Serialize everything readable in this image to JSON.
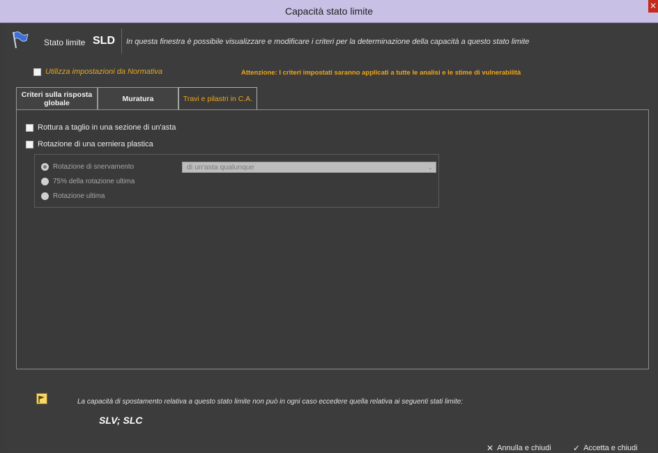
{
  "window": {
    "title": "Capacità stato limite",
    "close_glyph": "×"
  },
  "header": {
    "icon": "blue-flag-icon",
    "stato_label": "Stato limite",
    "stato_code": "SLD",
    "description": "In questa finestra è possibile visualizzare e modificare i criteri per la determinazione della capacità a questo stato limite"
  },
  "normativa": {
    "label": "Utilizza impostazioni da Normativa",
    "checked": false
  },
  "attention": "Attenzione: I criteri impostati saranno applicati a tutte le analisi e le stime di vulnerabilità",
  "tabs": [
    {
      "label": "Criteri sulla risposta globale",
      "active": false
    },
    {
      "label": "Muratura",
      "active": false
    },
    {
      "label": "Travi e pilastri in C.A.",
      "active": true
    }
  ],
  "panel": {
    "options": [
      {
        "label": "Rottura a taglio in una sezione di un'asta",
        "checked": false
      },
      {
        "label": "Rotazione di una cerniera plastica",
        "checked": false
      }
    ],
    "radios": [
      {
        "label": "Rotazione di snervamento",
        "selected": true
      },
      {
        "label": "75% della rotazione ultima",
        "selected": false
      },
      {
        "label": "Rotazione ultima",
        "selected": false
      }
    ],
    "select_value": "di un'asta qualunque"
  },
  "footer": {
    "info_icon": "yellow-flag-icon",
    "info_text": "La capacità di spostamento relativa a questo stato limite non può in ogni caso eccedere quella relativa ai seguenti stati limite:",
    "states": "SLV; SLC",
    "cancel_label": "Annulla e chiudi",
    "accept_label": "Accetta e chiudi"
  },
  "colors": {
    "accent": "#f2a619",
    "background": "#3b3b3b",
    "titlebar": "#c9c0e6"
  }
}
